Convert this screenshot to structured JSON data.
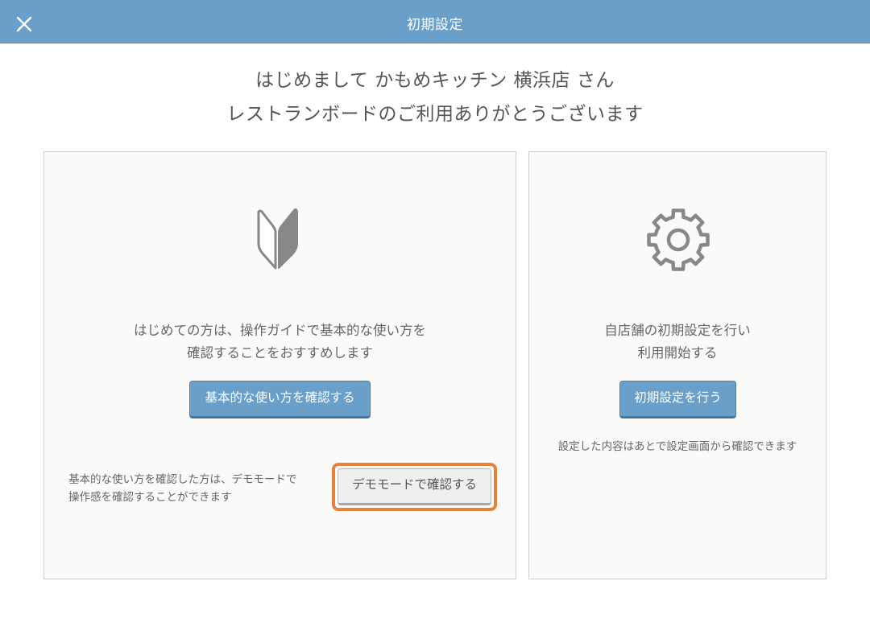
{
  "header": {
    "title": "初期設定",
    "close_icon": "close-icon"
  },
  "greeting": {
    "line1": "はじめまして かもめキッチン 横浜店 さん",
    "line2": "レストランボードのご利用ありがとうございます"
  },
  "guide_card": {
    "icon": "beginner-mark-icon",
    "description_line1": "はじめての方は、操作ガイドで基本的な使い方を",
    "description_line2": "確認することをおすすめします",
    "button_label": "基本的な使い方を確認する",
    "demo_note_line1": "基本的な使い方を確認した方は、デモモードで",
    "demo_note_line2": "操作感を確認することができます",
    "demo_button_label": "デモモードで確認する"
  },
  "setup_card": {
    "icon": "gear-icon",
    "description_line1": "自店舗の初期設定を行い",
    "description_line2": "利用開始する",
    "button_label": "初期設定を行う",
    "note": "設定した内容はあとで設定画面から確認できます"
  },
  "colors": {
    "header_bg": "#6a9fc9",
    "primary_button": "#6a9fc9",
    "highlight": "#e8823a",
    "icon_gray": "#888888"
  }
}
